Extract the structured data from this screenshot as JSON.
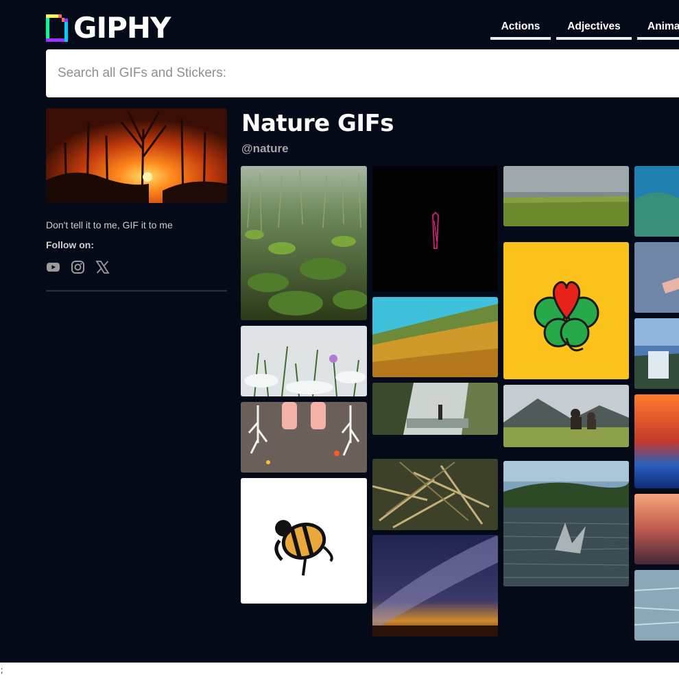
{
  "header": {
    "logo_text": "GIPHY",
    "nav_tabs": [
      {
        "label": "Actions"
      },
      {
        "label": "Adjectives"
      },
      {
        "label": "Anima"
      }
    ]
  },
  "search": {
    "placeholder": "Search all GIFs and Stickers:",
    "value": ""
  },
  "channel": {
    "title": "Nature GIFs",
    "handle": "@nature",
    "tagline": "Don't tell it to me, GIF it to me",
    "follow_label": "Follow on:",
    "socials": [
      "youtube-icon",
      "instagram-icon",
      "x-icon"
    ]
  },
  "stray_text": ";",
  "colors": {
    "page_bg": "#040a18",
    "nav_underline": "#f2f2f2",
    "search_bg": "#ffffff",
    "sticker_yellow": "#fbc21b",
    "muted_text": "#a6a6a6"
  }
}
